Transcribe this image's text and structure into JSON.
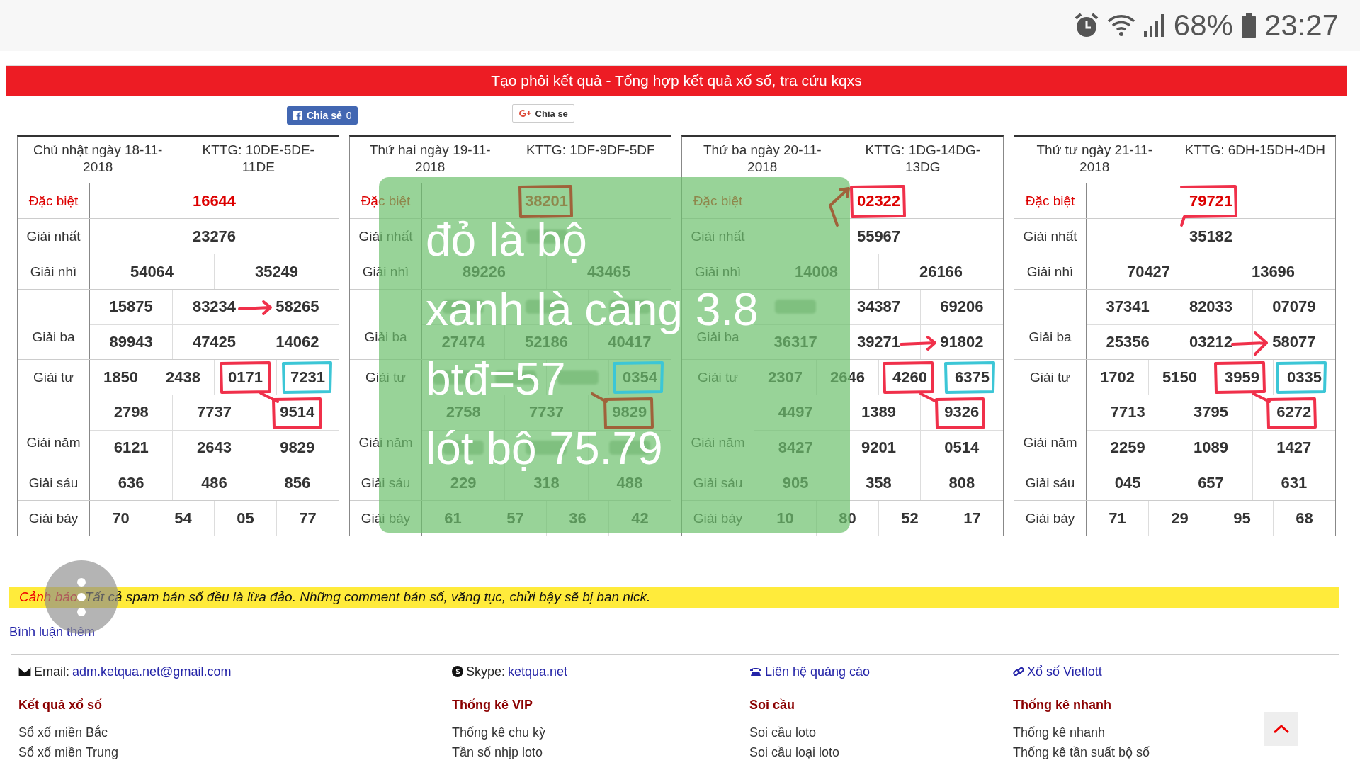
{
  "status_bar": {
    "battery": "68%",
    "time": "23:27"
  },
  "banner": {
    "title": "Tạo phôi kết quả - Tổng hợp kết quả xổ số, tra cứu kqxs"
  },
  "share": {
    "facebook_label": "Chia sẻ",
    "facebook_count": "0",
    "google_label": "Chia sẻ"
  },
  "tables": [
    {
      "date": "Chủ nhật ngày 18-11-2018",
      "kttg": "KTTG: 10DE-5DE-11DE",
      "prizes": [
        {
          "label": "Đặc biệt",
          "kind": "special",
          "lines": [
            [
              "16644"
            ]
          ]
        },
        {
          "label": "Giải nhất",
          "kind": "normal",
          "lines": [
            [
              "23276"
            ]
          ]
        },
        {
          "label": "Giải nhì",
          "kind": "normal",
          "lines": [
            [
              "54064",
              "35249"
            ]
          ]
        },
        {
          "label": "Giải ba",
          "kind": "normal",
          "lines": [
            [
              "15875",
              "83234",
              "58265"
            ],
            [
              "89943",
              "47425",
              "14062"
            ]
          ]
        },
        {
          "label": "Giải tư",
          "kind": "normal",
          "lines": [
            [
              "1850",
              "2438",
              "0171",
              "7231"
            ]
          ]
        },
        {
          "label": "Giải năm",
          "kind": "normal",
          "lines": [
            [
              "2798",
              "7737",
              "9514"
            ],
            [
              "6121",
              "2643",
              "9829"
            ]
          ]
        },
        {
          "label": "Giải sáu",
          "kind": "normal",
          "lines": [
            [
              "636",
              "486",
              "856"
            ]
          ]
        },
        {
          "label": "Giải bảy",
          "kind": "normal",
          "lines": [
            [
              "70",
              "54",
              "05",
              "77"
            ]
          ]
        }
      ]
    },
    {
      "date": "Thứ hai ngày 19-11-2018",
      "kttg": "KTTG: 1DF-9DF-5DF",
      "prizes": [
        {
          "label": "Đặc biệt",
          "kind": "special",
          "lines": [
            [
              "38201"
            ]
          ]
        },
        {
          "label": "Giải nhất",
          "kind": "normal",
          "lines": [
            [
              {
                "covered": true
              }
            ]
          ]
        },
        {
          "label": "Giải nhì",
          "kind": "normal",
          "lines": [
            [
              "89226",
              "43465"
            ]
          ]
        },
        {
          "label": "Giải ba",
          "kind": "normal",
          "lines": [
            [
              {
                "covered": true
              },
              {
                "covered": true
              },
              {
                "covered": true
              }
            ],
            [
              "27474",
              "52186",
              "40417"
            ]
          ]
        },
        {
          "label": "Giải tư",
          "kind": "normal",
          "lines": [
            [
              {
                "covered": true
              },
              {
                "covered": true
              },
              {
                "covered": true
              },
              "0354"
            ]
          ]
        },
        {
          "label": "Giải năm",
          "kind": "normal",
          "lines": [
            [
              "2758",
              "7737",
              "9829"
            ],
            [
              {
                "covered": true
              },
              {
                "covered": true
              },
              {
                "covered": true
              }
            ]
          ]
        },
        {
          "label": "Giải sáu",
          "kind": "normal",
          "lines": [
            [
              "229",
              "318",
              "488"
            ]
          ]
        },
        {
          "label": "Giải bảy",
          "kind": "normal",
          "lines": [
            [
              "61",
              "57",
              "36",
              "42"
            ]
          ]
        }
      ]
    },
    {
      "date": "Thứ ba ngày 20-11-2018",
      "kttg": "KTTG: 1DG-14DG-13DG",
      "prizes": [
        {
          "label": "Đặc biệt",
          "kind": "special",
          "lines": [
            [
              "02322"
            ]
          ]
        },
        {
          "label": "Giải nhất",
          "kind": "normal",
          "lines": [
            [
              "55967"
            ]
          ]
        },
        {
          "label": "Giải nhì",
          "kind": "normal",
          "lines": [
            [
              "14008",
              "26166"
            ]
          ]
        },
        {
          "label": "Giải ba",
          "kind": "normal",
          "lines": [
            [
              {
                "covered": true
              },
              "34387",
              "69206"
            ],
            [
              "36317",
              "39271",
              "91802"
            ]
          ]
        },
        {
          "label": "Giải tư",
          "kind": "normal",
          "lines": [
            [
              "2307",
              "2646",
              "4260",
              "6375"
            ]
          ]
        },
        {
          "label": "Giải năm",
          "kind": "normal",
          "lines": [
            [
              "4497",
              "1389",
              "9326"
            ],
            [
              "8427",
              "9201",
              "0514"
            ]
          ]
        },
        {
          "label": "Giải sáu",
          "kind": "normal",
          "lines": [
            [
              "905",
              "358",
              "808"
            ]
          ]
        },
        {
          "label": "Giải bảy",
          "kind": "normal",
          "lines": [
            [
              "10",
              "80",
              "52",
              "17"
            ]
          ]
        }
      ]
    },
    {
      "date": "Thứ tư ngày 21-11-2018",
      "kttg": "KTTG: 6DH-15DH-4DH",
      "prizes": [
        {
          "label": "Đặc biệt",
          "kind": "special",
          "lines": [
            [
              "79721"
            ]
          ]
        },
        {
          "label": "Giải nhất",
          "kind": "normal",
          "lines": [
            [
              "35182"
            ]
          ]
        },
        {
          "label": "Giải nhì",
          "kind": "normal",
          "lines": [
            [
              "70427",
              "13696"
            ]
          ]
        },
        {
          "label": "Giải ba",
          "kind": "normal",
          "lines": [
            [
              "37341",
              "82033",
              "07079"
            ],
            [
              "25356",
              "03212",
              "58077"
            ]
          ]
        },
        {
          "label": "Giải tư",
          "kind": "normal",
          "lines": [
            [
              "1702",
              "5150",
              "3959",
              "0335"
            ]
          ]
        },
        {
          "label": "Giải năm",
          "kind": "normal",
          "lines": [
            [
              "7713",
              "3795",
              "6272"
            ],
            [
              "2259",
              "1089",
              "1427"
            ]
          ]
        },
        {
          "label": "Giải sáu",
          "kind": "normal",
          "lines": [
            [
              "045",
              "657",
              "631"
            ]
          ]
        },
        {
          "label": "Giải bảy",
          "kind": "normal",
          "lines": [
            [
              "71",
              "29",
              "95",
              "68"
            ]
          ]
        }
      ]
    }
  ],
  "note_overlay": {
    "lines": [
      "đỏ là bộ",
      "xanh là càng 3.8",
      "btđ=57",
      "lót bộ 75.79"
    ]
  },
  "warning": {
    "label": "Cảnh báo:",
    "text": "Tất cả spam bán số đều là lừa đảo. Những comment bán số, văng tục, chửi bậy sẽ bị ban nick."
  },
  "more_comments": "Bình luận thêm",
  "contacts": [
    {
      "kind": "email",
      "label": "Email:",
      "link": "adm.ketqua.net@gmail.com"
    },
    {
      "kind": "skype",
      "label": "Skype:",
      "link": "ketqua.net"
    },
    {
      "kind": "phone",
      "link": "Liên hệ quảng cáo"
    },
    {
      "kind": "chain",
      "link": "Xổ số Vietlott"
    }
  ],
  "footer_columns": [
    {
      "heading": "Kết quả xổ số",
      "items": [
        "Sổ xố miền Bắc",
        "Sổ xố miền Trung"
      ]
    },
    {
      "heading": "Thống kê VIP",
      "items": [
        "Thống kê chu kỳ",
        "Tần số nhịp loto"
      ]
    },
    {
      "heading": "Soi cầu",
      "items": [
        "Soi cầu loto",
        "Soi cầu loại loto"
      ]
    },
    {
      "heading": "Thống kê nhanh",
      "items": [
        "Thống kê nhanh",
        "Thống kê tần suất bộ số"
      ]
    }
  ]
}
